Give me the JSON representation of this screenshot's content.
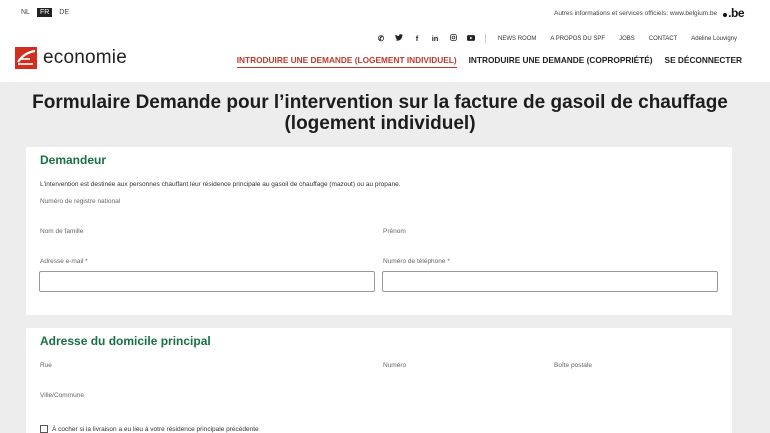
{
  "languages": [
    {
      "code": "NL",
      "active": false
    },
    {
      "code": "FR",
      "active": true
    },
    {
      "code": "DE",
      "active": false
    }
  ],
  "belgium": {
    "text": "Autres informations et services officiels: www.belgium.be",
    "logo": ".be"
  },
  "topnav": {
    "icons": [
      "phone-icon",
      "twitter-icon",
      "facebook-icon",
      "linkedin-icon",
      "instagram-icon",
      "youtube-icon"
    ],
    "links": [
      "NEWS ROOM",
      "A PROPOS DU SPF",
      "JOBS",
      "CONTACT",
      "Adeline Louvigny"
    ]
  },
  "brand": {
    "name": "economie",
    "color": "#d12e1f"
  },
  "mainnav": [
    {
      "label": "INTRODUIRE UNE DEMANDE (LOGEMENT INDIVIDUEL)",
      "active": true
    },
    {
      "label": "INTRODUIRE UNE DEMANDE (COPROPRIÉTÉ)",
      "active": false
    },
    {
      "label": "SE DÉCONNECTER",
      "active": false
    }
  ],
  "page": {
    "title": "Formulaire Demande pour l’intervention sur la facture de gasoil de chauffage (logement individuel)"
  },
  "demandeur": {
    "title": "Demandeur",
    "intro": "L'intervention est destinée aux personnes chauffant leur résidence principale au gasoil de chauffage (mazout) ou au propane.",
    "national_register_label": "Numéro de registre national",
    "lastname_label": "Nom de famille",
    "firstname_label": "Prénom",
    "email_label": "Adresse e-mail *",
    "phone_label": "Numéro de téléphone *",
    "email_value": "",
    "phone_value": ""
  },
  "address": {
    "title": "Adresse du domicile principal",
    "street_label": "Rue",
    "number_label": "Numéro",
    "box_label": "Boîte postale",
    "city_label": "Ville/Commune",
    "checkbox_label": "À cocher si la livraison a eu lieu à votre résidence principale précédente"
  },
  "colors": {
    "accent_red": "#c1382a",
    "section_green": "#197046",
    "background": "#ededed"
  }
}
